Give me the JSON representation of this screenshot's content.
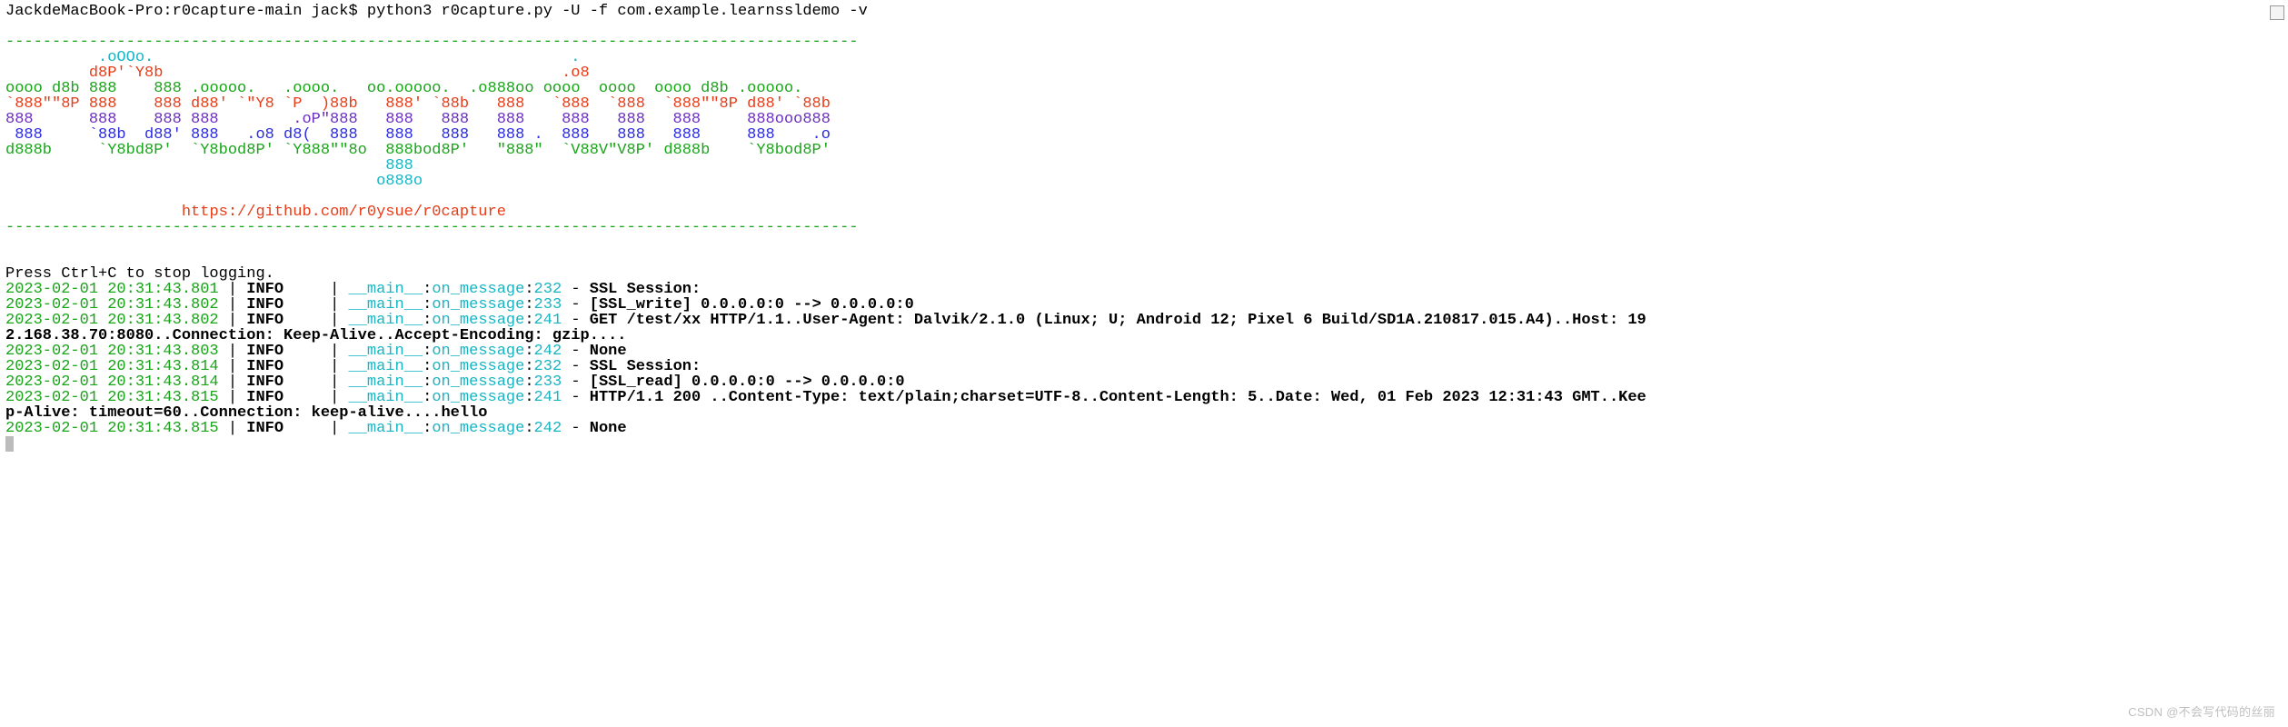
{
  "prompt": {
    "host": "JackdeMacBook-Pro:r0capture-main jack$ ",
    "command": "python3 r0capture.py -U -f com.example.learnssldemo -v"
  },
  "divider": "--------------------------------------------------------------------------------------------",
  "banner": {
    "l01a": "          .oOOo.                                             .",
    "l02a": "         d8P'`Y8b                                           .o8",
    "l03a": "oooo d8b 888    888",
    "l03b": " .ooooo.   .oooo.   oo.ooooo.",
    "l03c": "  .o888oo oooo  oooo  oooo d8b .ooooo.",
    "l04a": "`888\"\"8P 888    888 d88' `\"Y8 `P  )88b   888' `88b   888   `888  `888  `888\"\"8P d88' `88b",
    "l05a": "888      888    888 888        .oP\"888   888   888   888    888   888   888     888ooo888",
    "l06a": " 888     `88b  d88' 888   .o8 d8(  888   888   888   888 .  888   888   888     888    .o",
    "l07a": "d888b     `Y8bd8P'  `Y8bod8P' `Y888\"\"8o  888bod8P'   \"888\"  `V88V\"V8P' d888b    `Y8bod8P'",
    "l08a": "                                         888",
    "l09a": "                                        o888o",
    "url_pad": "                   ",
    "url": "https://github.com/r0ysue/r0capture"
  },
  "stop_msg": "Press Ctrl+C to stop logging.",
  "log_tokens": {
    "info": "INFO",
    "sep_pipe": " | ",
    "sep_dash": " - ",
    "module": "__main__",
    "colon": ":",
    "func": "on_message"
  },
  "logs": [
    {
      "ts": "2023-02-01 20:31:43.801",
      "line": "232",
      "msg": "SSL Session:"
    },
    {
      "ts": "2023-02-01 20:31:43.802",
      "line": "233",
      "msg": "[SSL_write] 0.0.0.0:0 --> 0.0.0.0:0"
    },
    {
      "ts": "2023-02-01 20:31:43.802",
      "line": "241",
      "msg": "GET /test/xx HTTP/1.1..User-Agent: Dalvik/2.1.0 (Linux; U; Android 12; Pixel 6 Build/SD1A.210817.015.A4)..Host: 19",
      "wrap": "2.168.38.70:8080..Connection: Keep-Alive..Accept-Encoding: gzip...."
    },
    {
      "ts": "2023-02-01 20:31:43.803",
      "line": "242",
      "msg": "None"
    },
    {
      "ts": "2023-02-01 20:31:43.814",
      "line": "232",
      "msg": "SSL Session:"
    },
    {
      "ts": "2023-02-01 20:31:43.814",
      "line": "233",
      "msg": "[SSL_read] 0.0.0.0:0 --> 0.0.0.0:0"
    },
    {
      "ts": "2023-02-01 20:31:43.815",
      "line": "241",
      "msg": "HTTP/1.1 200 ..Content-Type: text/plain;charset=UTF-8..Content-Length: 5..Date: Wed, 01 Feb 2023 12:31:43 GMT..Kee",
      "wrap": "p-Alive: timeout=60..Connection: keep-alive....hello"
    },
    {
      "ts": "2023-02-01 20:31:43.815",
      "line": "242",
      "msg": "None"
    }
  ],
  "watermark": "CSDN @不会写代码的丝丽"
}
